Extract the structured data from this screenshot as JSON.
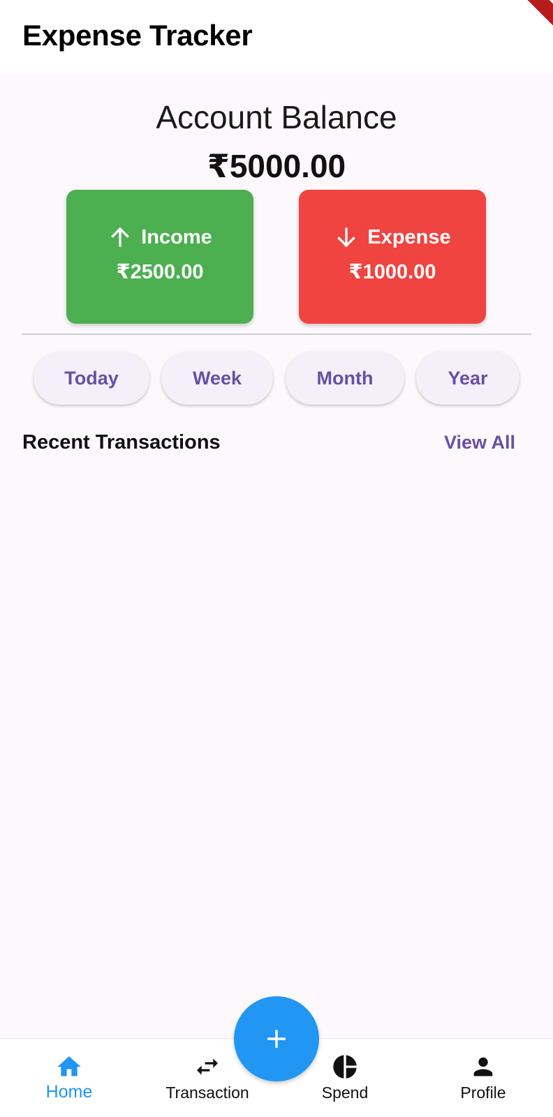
{
  "app_bar": {
    "title": "Expense Tracker"
  },
  "balance": {
    "label": "Account Balance",
    "amount": "₹5000.00"
  },
  "summary_cards": {
    "income": {
      "label": "Income",
      "amount": "₹2500.00",
      "icon": "arrow-up-icon",
      "color": "#4caf50"
    },
    "expense": {
      "label": "Expense",
      "amount": "₹1000.00",
      "icon": "arrow-down-icon",
      "color": "#ef4440"
    }
  },
  "period_filters": [
    "Today",
    "Week",
    "Month",
    "Year"
  ],
  "recent_transactions": {
    "title": "Recent Transactions",
    "view_all_label": "View All",
    "items": []
  },
  "bottom_nav": {
    "items": [
      {
        "label": "Home",
        "icon": "home-icon",
        "active": true
      },
      {
        "label": "Transaction",
        "icon": "swap-arrows-icon",
        "active": false
      },
      {
        "label": "Spend",
        "icon": "pie-chart-icon",
        "active": false
      },
      {
        "label": "Profile",
        "icon": "person-icon",
        "active": false
      }
    ],
    "fab_icon": "plus-icon"
  },
  "colors": {
    "accent": "#6750a4",
    "primary_blue": "#2196f3",
    "background": "#fdf8fc"
  }
}
